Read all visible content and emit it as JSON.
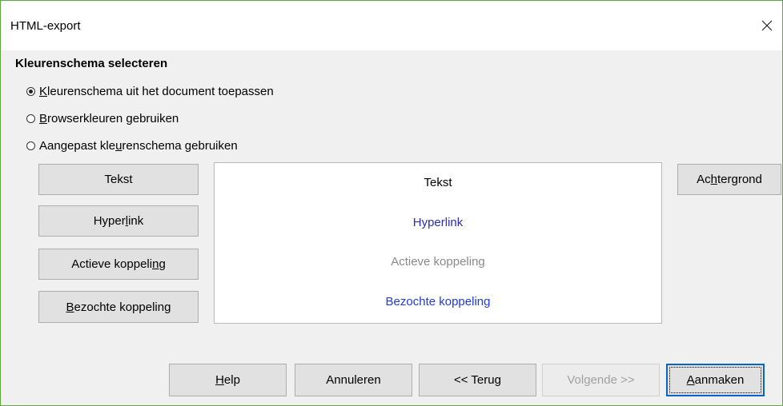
{
  "window": {
    "title": "HTML-export",
    "close_icon": "close-icon"
  },
  "section": {
    "title": "Kleurenschema selecteren"
  },
  "radios": [
    {
      "pre": "",
      "acc": "K",
      "post": "leurenschema uit het document toepassen",
      "checked": true
    },
    {
      "pre": "",
      "acc": "B",
      "post": "rowserkleuren gebruiken",
      "checked": false
    },
    {
      "pre": "Aangepast kle",
      "acc": "u",
      "post": "renschema gebruiken",
      "checked": false
    }
  ],
  "color_buttons": [
    {
      "pre": "Tekst",
      "acc": "",
      "post": ""
    },
    {
      "pre": "Hyper",
      "acc": "l",
      "post": "ink"
    },
    {
      "pre": "Actieve koppeli",
      "acc": "n",
      "post": "g"
    },
    {
      "pre": "",
      "acc": "B",
      "post": "ezochte koppeling"
    }
  ],
  "background_button": {
    "pre": "Ac",
    "acc": "h",
    "post": "tergrond"
  },
  "preview": {
    "text": "Tekst",
    "hyperlink": "Hyperlink",
    "active_link": "Actieve koppeling",
    "visited_link": "Bezochte koppeling",
    "colors": {
      "text": "#000000",
      "hyperlink": "#2b2bb3",
      "active_link": "#8a8a8a",
      "visited_link": "#1f3bd4"
    }
  },
  "footer": {
    "help": {
      "pre": "",
      "acc": "H",
      "post": "elp"
    },
    "cancel": "Annuleren",
    "back": "<< Terug",
    "next": {
      "pre": "Vol",
      "acc": "g",
      "post": "ende >>"
    },
    "create": {
      "pre": "",
      "acc": "A",
      "post": "anmaken"
    }
  }
}
